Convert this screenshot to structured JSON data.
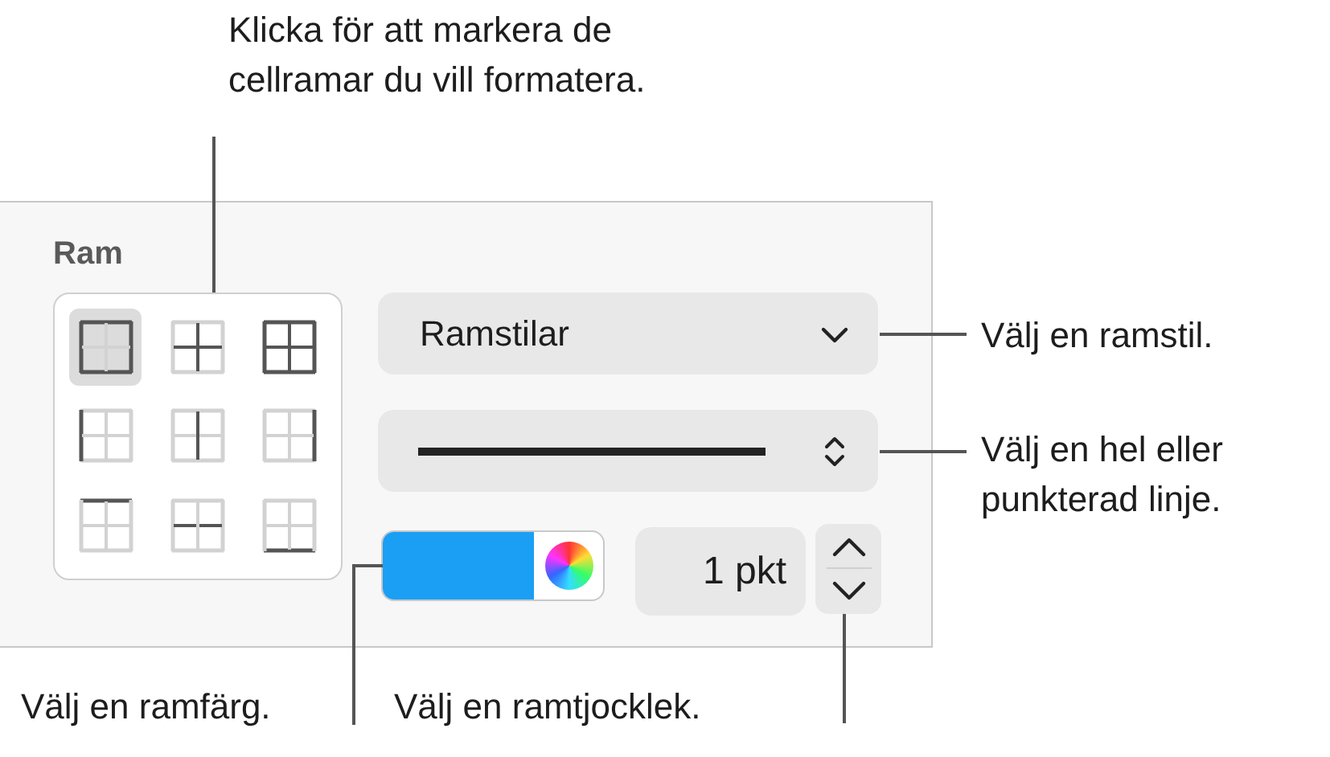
{
  "callouts": [
    {
      "text": "Klicka för att markera de cellramar du vill formatera."
    },
    {
      "text": "Välj en ramstil."
    },
    {
      "text": "Välj en hel eller punkterad linje."
    },
    {
      "text": "Välj en ramfärg."
    },
    {
      "text": "Välj en ramtjocklek."
    }
  ],
  "panel": {
    "title": "Ram",
    "border_buttons": [
      {
        "kind": "outer",
        "selected": true
      },
      {
        "kind": "inner",
        "selected": false
      },
      {
        "kind": "all",
        "selected": false
      },
      {
        "kind": "left",
        "selected": false
      },
      {
        "kind": "vertical",
        "selected": false
      },
      {
        "kind": "right",
        "selected": false
      },
      {
        "kind": "top",
        "selected": false
      },
      {
        "kind": "horizontal",
        "selected": false
      },
      {
        "kind": "bottom",
        "selected": false
      }
    ],
    "style_popup": {
      "value": "Ramstilar"
    },
    "line_popup": {
      "kind": "solid"
    },
    "color_well": {
      "color": "#1a9ff5"
    },
    "width_field": {
      "value": "1 pkt"
    }
  }
}
